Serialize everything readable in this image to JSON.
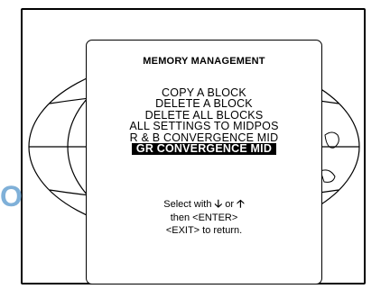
{
  "dialog": {
    "title": "MEMORY MANAGEMENT",
    "menu_items": [
      "COPY A BLOCK",
      "DELETE A BLOCK",
      "DELETE ALL BLOCKS",
      "ALL SETTINGS TO MIDPOS",
      "R & B CONVERGENCE MID",
      "GR CONVERGENCE MID"
    ],
    "selected_index": 5,
    "help": {
      "line1_prefix": "Select with",
      "line1_or": "or",
      "down_arrow": "🡣",
      "up_arrow": "🡡",
      "line2": "then <ENTER>",
      "line3": "<EXIT> to return."
    }
  },
  "watermark_text": "O",
  "colors": {
    "background": "#ffffff",
    "foreground": "#000000",
    "highlight_bg": "#000000",
    "highlight_fg": "#ffffff",
    "watermark": "#7fb0d8"
  }
}
